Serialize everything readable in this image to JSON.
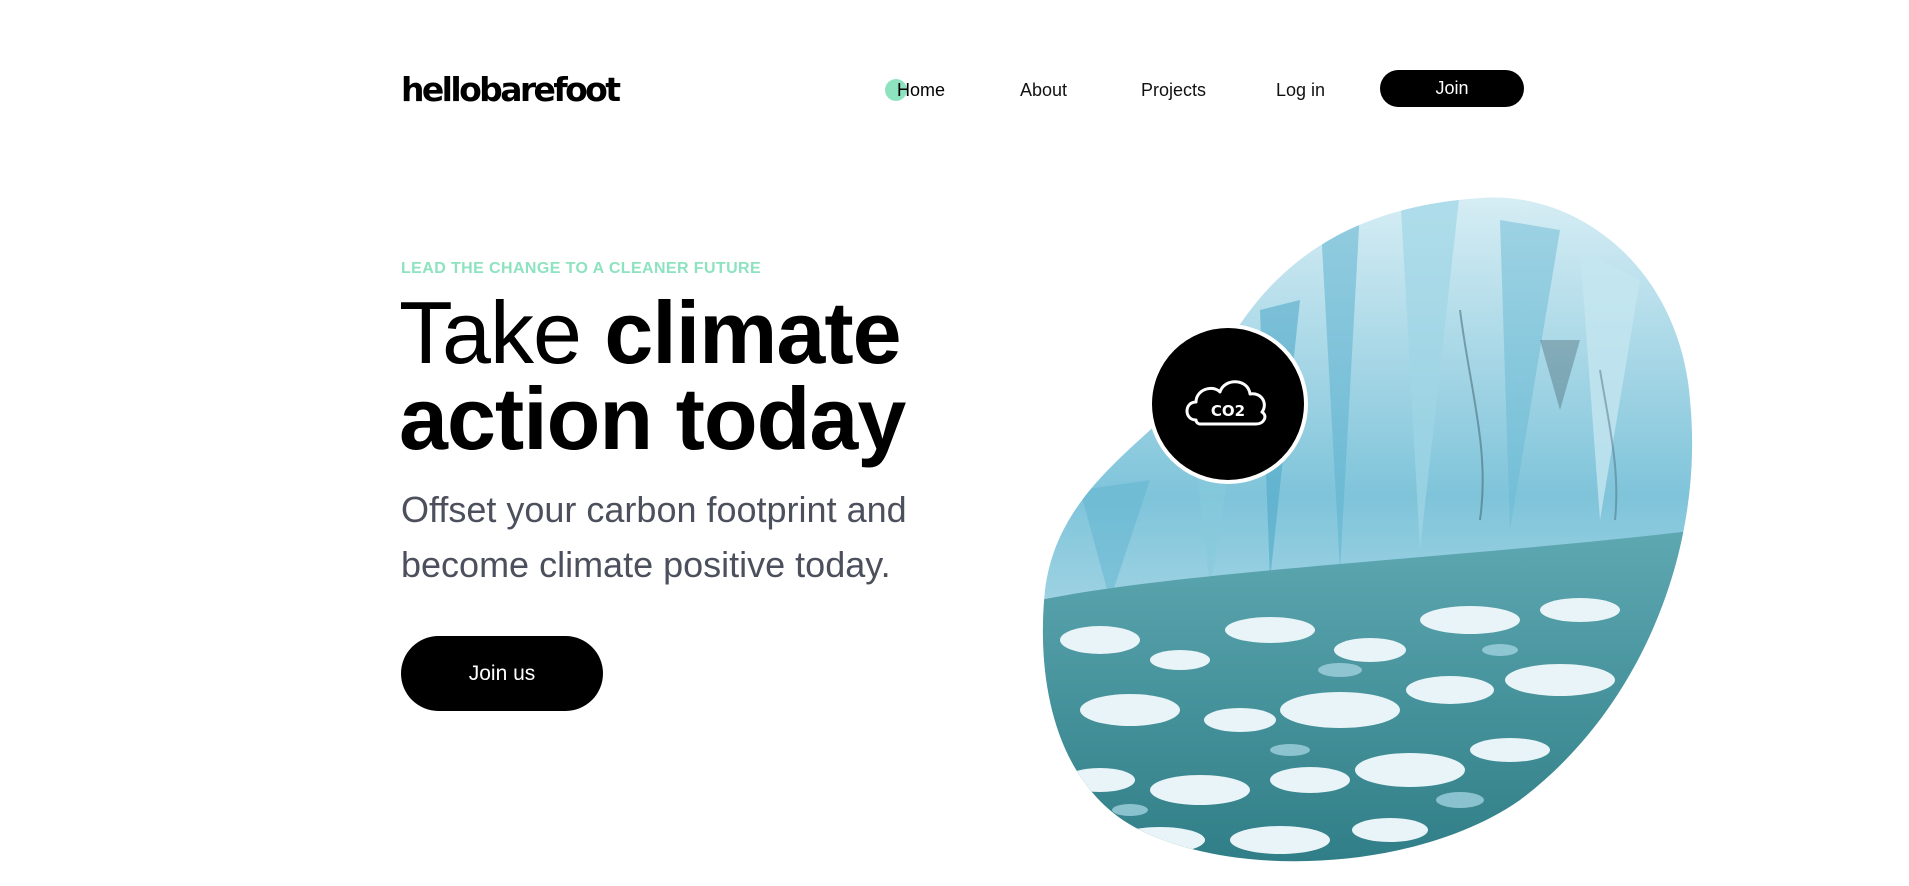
{
  "header": {
    "logo": "hellobarefoot",
    "nav": {
      "items": [
        {
          "label": "Home",
          "active": true
        },
        {
          "label": "About",
          "active": false
        },
        {
          "label": "Projects",
          "active": false
        },
        {
          "label": "Log in",
          "active": false
        }
      ],
      "join_label": "Join"
    }
  },
  "hero": {
    "eyebrow": "LEAD THE CHANGE TO A CLEANER FUTURE",
    "headline_light": "Take",
    "headline_bold_1": "climate",
    "headline_bold_2": "action today",
    "subtext": "Offset your carbon footprint and become climate positive today.",
    "cta_label": "Join us",
    "badge_icon": "cloud-co2-icon",
    "badge_text": "CO2",
    "image_subject": "glacier-ice-image"
  },
  "colors": {
    "accent": "#8de3bf",
    "primary": "#000000",
    "subtext": "#4b505c",
    "background": "#ffffff"
  }
}
